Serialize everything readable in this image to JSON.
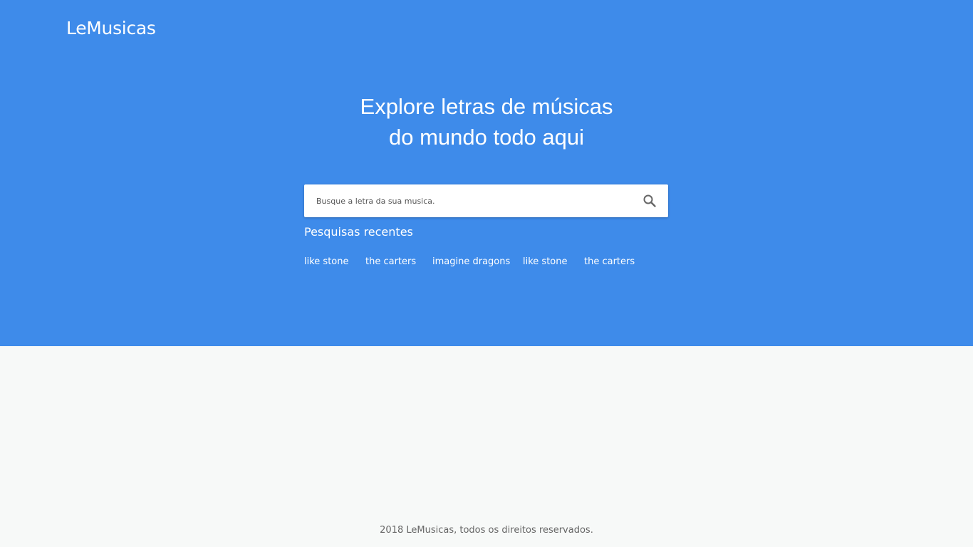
{
  "header": {
    "logo": "LeMusicas"
  },
  "hero": {
    "headline_line1": "Explore letras de músicas",
    "headline_line2": "do mundo todo aqui"
  },
  "search": {
    "placeholder": "Busque a letra da sua musica.",
    "value": "",
    "button_icon": "search-icon"
  },
  "recent": {
    "title": "Pesquisas recentes",
    "items": [
      {
        "label": "like stone"
      },
      {
        "label": "the carters"
      },
      {
        "label": "imagine dragons"
      },
      {
        "label": "like stone"
      },
      {
        "label": "the carters"
      }
    ]
  },
  "footer": {
    "text": "2018 LeMusicas, todos os direitos reservados."
  },
  "colors": {
    "hero_background": "#3e8bea",
    "content_background": "#f7f9f8",
    "text_on_hero": "#ffffff",
    "footer_text": "#666666"
  }
}
